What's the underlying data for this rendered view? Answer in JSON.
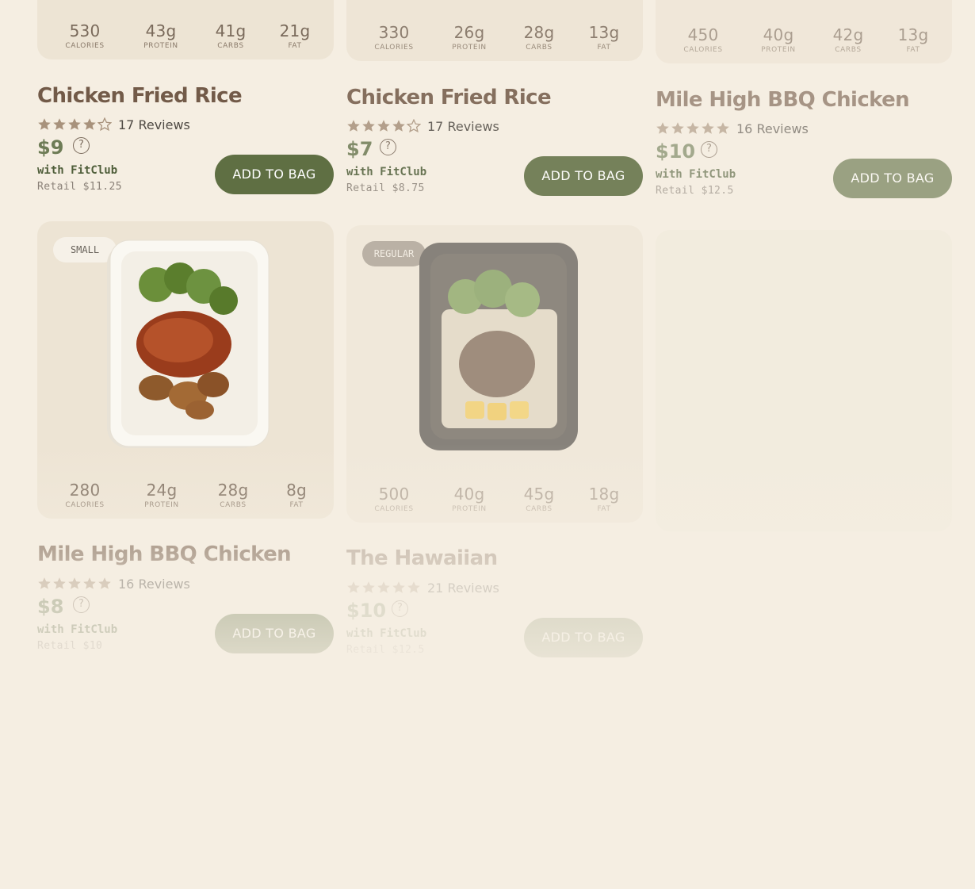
{
  "ui": {
    "help_glyph": "?",
    "stars_icon": "star-icon",
    "help_icon": "question-circle-icon",
    "accent_green": "#5f6f43",
    "background": "#f5eee2"
  },
  "cards": [
    {
      "macros": [
        {
          "value": "530",
          "label": "CALORIES"
        },
        {
          "value": "43g",
          "label": "PROTEIN"
        },
        {
          "value": "41g",
          "label": "CARBS"
        },
        {
          "value": "21g",
          "label": "FAT"
        }
      ],
      "name": "Chicken Fried Rice",
      "rating": 4,
      "reviews": "17 Reviews",
      "price": "$9",
      "fitclub": "with FitClub",
      "retail": "Retail $11.25",
      "button": "ADD TO BAG"
    },
    {
      "macros": [
        {
          "value": "330",
          "label": "CALORIES"
        },
        {
          "value": "26g",
          "label": "PROTEIN"
        },
        {
          "value": "28g",
          "label": "CARBS"
        },
        {
          "value": "13g",
          "label": "FAT"
        }
      ],
      "name": "Chicken Fried Rice",
      "rating": 4,
      "reviews": "17 Reviews",
      "price": "$7",
      "fitclub": "with FitClub",
      "retail": "Retail $8.75",
      "button": "ADD TO BAG"
    },
    {
      "macros": [
        {
          "value": "450",
          "label": "CALORIES"
        },
        {
          "value": "40g",
          "label": "PROTEIN"
        },
        {
          "value": "42g",
          "label": "CARBS"
        },
        {
          "value": "13g",
          "label": "FAT"
        }
      ],
      "name": "Mile High BBQ Chicken",
      "rating": 5,
      "reviews": "16 Reviews",
      "price": "$10",
      "fitclub": "with FitClub",
      "retail": "Retail $12.5",
      "button": "ADD TO BAG"
    },
    {
      "badge": "SMALL",
      "macros": [
        {
          "value": "280",
          "label": "CALORIES"
        },
        {
          "value": "24g",
          "label": "PROTEIN"
        },
        {
          "value": "28g",
          "label": "CARBS"
        },
        {
          "value": "8g",
          "label": "FAT"
        }
      ],
      "name": "Mile High BBQ Chicken",
      "rating": 5,
      "reviews": "16 Reviews",
      "price": "$8",
      "fitclub": "with FitClub",
      "retail": "Retail $10",
      "button": "ADD TO BAG"
    },
    {
      "badge": "REGULAR",
      "macros": [
        {
          "value": "500",
          "label": "CALORIES"
        },
        {
          "value": "40g",
          "label": "PROTEIN"
        },
        {
          "value": "45g",
          "label": "CARBS"
        },
        {
          "value": "18g",
          "label": "FAT"
        }
      ],
      "name": "The Hawaiian",
      "rating": 5,
      "reviews": "21 Reviews",
      "price": "$10",
      "fitclub": "with FitClub",
      "retail": "Retail $12.5",
      "button": "ADD TO BAG"
    }
  ]
}
